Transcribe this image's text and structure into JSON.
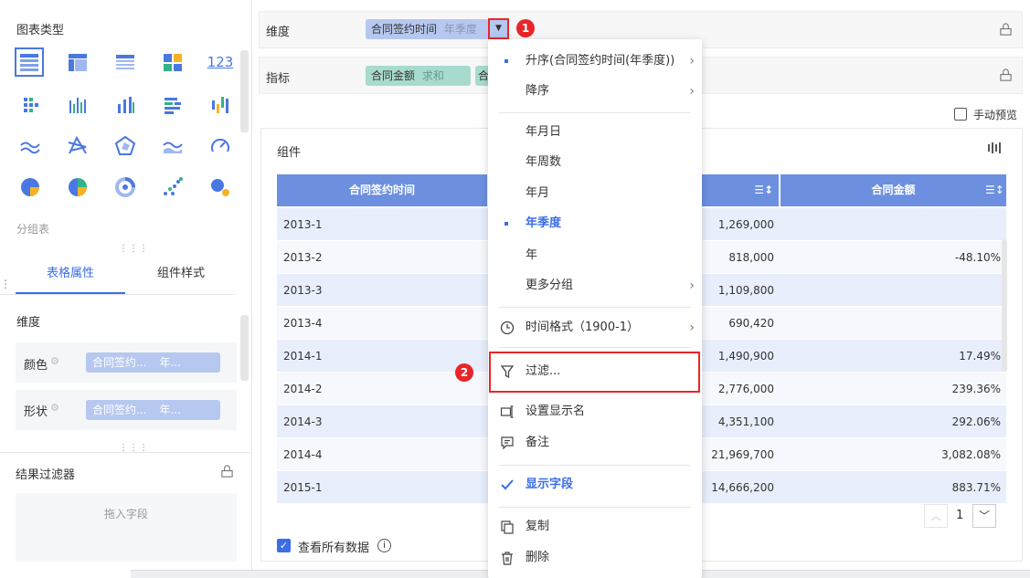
{
  "left": {
    "chart_type_title": "图表类型",
    "chart_icons": [
      "table-icon",
      "cross-table-icon",
      "detail-table-icon",
      "tile-icon",
      "number-123-icon",
      "scatter-bar-icon",
      "grouped-bar-icon",
      "bar-icon",
      "horizontal-bar-icon",
      "waterfall-icon",
      "line-icon",
      "radar-line-icon",
      "radar-icon",
      "area-icon",
      "gauge-icon",
      "pie-icon",
      "multi-pie-icon",
      "donut-icon",
      "scatter-icon",
      "bubble-icon"
    ],
    "chart_123_label": "123",
    "group_table_label": "分组表",
    "tabs": {
      "table_props": "表格属性",
      "component_style": "组件样式"
    },
    "dimension_label": "维度",
    "color_label": "颜色",
    "color_field": "合同签约...",
    "color_field_suffix": "年...",
    "shape_label": "形状",
    "shape_field": "合同签约...",
    "shape_field_suffix": "年...",
    "result_filter_label": "结果过滤器",
    "drag_field_label": "拖入字段"
  },
  "main": {
    "dimension_label": "维度",
    "dimension_field": "合同签约时间",
    "dimension_field_suffix": "年季度",
    "metric_label": "指标",
    "metric_field": "合同金额",
    "metric_field_suffix": "求和",
    "metric_field2_initial": "合",
    "manual_preview_label": "手动预览",
    "component_label": "组件",
    "table": {
      "headers": [
        "合同签约时间",
        "合同金额"
      ],
      "rows": [
        {
          "period": "2013-1",
          "amount": "1,269,000",
          "rate": ""
        },
        {
          "period": "2013-2",
          "amount": "818,000",
          "rate": "-48.10%"
        },
        {
          "period": "2013-3",
          "amount": "1,109,800",
          "rate": ""
        },
        {
          "period": "2013-4",
          "amount": "690,420",
          "rate": ""
        },
        {
          "period": "2014-1",
          "amount": "1,490,900",
          "rate": "17.49%"
        },
        {
          "period": "2014-2",
          "amount": "2,776,000",
          "rate": "239.36%"
        },
        {
          "period": "2014-3",
          "amount": "4,351,100",
          "rate": "292.06%"
        },
        {
          "period": "2014-4",
          "amount": "21,969,700",
          "rate": "3,082.08%"
        },
        {
          "period": "2015-1",
          "amount": "14,666,200",
          "rate": "883.71%"
        }
      ]
    },
    "page_number": "1",
    "view_all_label": "查看所有数据"
  },
  "menu": {
    "asc": "升序(合同签约时间(年季度))",
    "desc": "降序",
    "ymd": "年月日",
    "year_week": "年周数",
    "year_month": "年月",
    "year_quarter": "年季度",
    "year": "年",
    "more_group": "更多分组",
    "time_format": "时间格式（1900-1）",
    "filter": "过滤...",
    "set_display_name": "设置显示名",
    "note": "备注",
    "show_field": "显示字段",
    "copy": "复制",
    "delete": "删除"
  },
  "badges": {
    "one": "1",
    "two": "2"
  },
  "colors": {
    "accent": "#3b6ee6",
    "header": "#6c8fe0",
    "highlight": "#e8262a",
    "dim_pill": "#b6c8ef",
    "metric_pill": "#a8dbd0"
  }
}
